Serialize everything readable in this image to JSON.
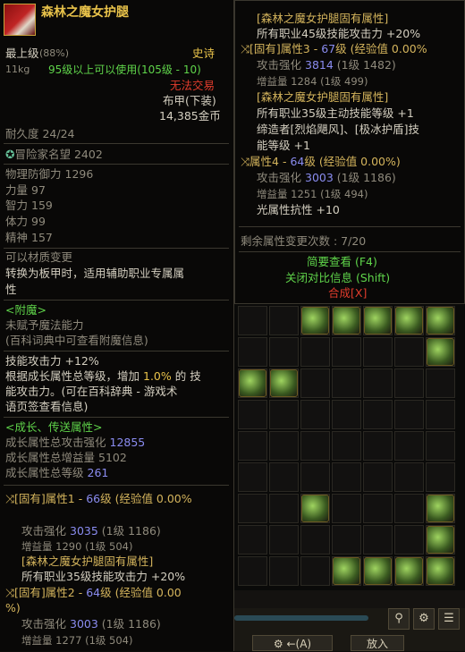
{
  "item": {
    "name": "森林之魔女护腿",
    "grade": "最上级",
    "grade_pct": "(88%)",
    "rarity": "史诗",
    "weight": "11kg",
    "level_req": "95级以上可以使用(105级 - 10)",
    "trade": "无法交易",
    "armor_type": "布甲(下装)",
    "price": "14,385金币",
    "durability": "耐久度 24/24",
    "adventure_label": "冒险家名望",
    "adventure_value": "2402"
  },
  "stats": [
    {
      "label": "物理防御力",
      "value": "1296"
    },
    {
      "label": "力量",
      "value": "97"
    },
    {
      "label": "智力",
      "value": "159"
    },
    {
      "label": "体力",
      "value": "99"
    },
    {
      "label": "精神",
      "value": "157"
    }
  ],
  "transform": {
    "title": "可以材质变更",
    "desc1": "转换为板甲时，适用辅助职业专属属",
    "desc2": "性"
  },
  "enchant": {
    "title": "<附魔>",
    "none": "未赋予魔法能力",
    "hint": "(百科词典中可查看附魔信息)"
  },
  "skill": {
    "line1": "技能攻击力 +12%",
    "line2a": "根据成长属性总等级，增加",
    "line2b": "1.0%",
    "line2c": "的 技",
    "line3": "能攻击力。(可在百科辞典 - 游戏术",
    "line4": "语页签查看信息)"
  },
  "growth": {
    "title": "<成长、传送属性>",
    "atk_label": "成长属性总攻击强化",
    "atk_value": "12855",
    "gain_label": "成长属性总增益量",
    "gain_value": "5102",
    "lvl_label": "成长属性总等级",
    "lvl_value": "261"
  },
  "attr1": {
    "head": "[固有]属性1 - ",
    "lvl": "66",
    "tail": "级 (经验值 0.00%",
    "atk_label": "攻击强化",
    "atk_value": "3035",
    "atk_base": "(1级 1186)",
    "gain_label": "增益量",
    "gain_value": "1290",
    "gain_base": "(1级 504)",
    "fixed_title": "[森林之魔女护腿固有属性]",
    "fixed_desc": "所有职业35级技能攻击力 +20%"
  },
  "attr2": {
    "head": "[固有]属性2 - ",
    "lvl": "64",
    "tail": "级 (经验值 0.00",
    "wrap": "%)",
    "atk_label": "攻击强化",
    "atk_value": "3003",
    "atk_base": "(1级 1186)",
    "gain_label": "增益量",
    "gain_value": "1277",
    "gain_base": "(1级 504)"
  },
  "right": {
    "fixed_title": "[森林之魔女护腿固有属性]",
    "fixed_desc": "所有职业45级技能攻击力 +20%",
    "attr3_head": "[固有]属性3 - ",
    "attr3_lvl": "67",
    "attr3_tail": "级 (经验值 0.00%",
    "atk_label": "攻击强化",
    "atk3_value": "3814",
    "atk3_base": "(1级 1482)",
    "gain_label": "增益量",
    "gain3_value": "1284",
    "gain3_base": "(1级 499)",
    "fixed2_title": "[森林之魔女护腿固有属性]",
    "fixed2_desc1": "所有职业35级主动技能等级 +1",
    "fixed2_desc2": "缔造者[烈焰飓风]、[极冰护盾]技",
    "fixed2_desc3": "能等级 +1",
    "attr4_head": "属性4 - ",
    "attr4_lvl": "64",
    "attr4_tail": "级 (经验值 0.00%)",
    "atk4_value": "3003",
    "atk4_base": "(1级 1186)",
    "gain4_value": "1251",
    "gain4_base": "(1级 494)",
    "light": "光属性抗性 +10",
    "remain": "剩余属性变更次数 : 7/20",
    "brief": "简要查看 (F4)",
    "compare": "关闭对比信息 (Shift)",
    "compose": "合成[X]"
  },
  "toolbar": {
    "search_icon": "search-icon",
    "settings_icon": "gear-icon",
    "list_icon": "list-icon",
    "btn_a_label": "(A)",
    "btn_in_label": "放入"
  },
  "colors": {
    "gold": "#e8c24a",
    "green": "#5fd44a",
    "red": "#e03c2c",
    "blue": "#8a8cf0"
  }
}
